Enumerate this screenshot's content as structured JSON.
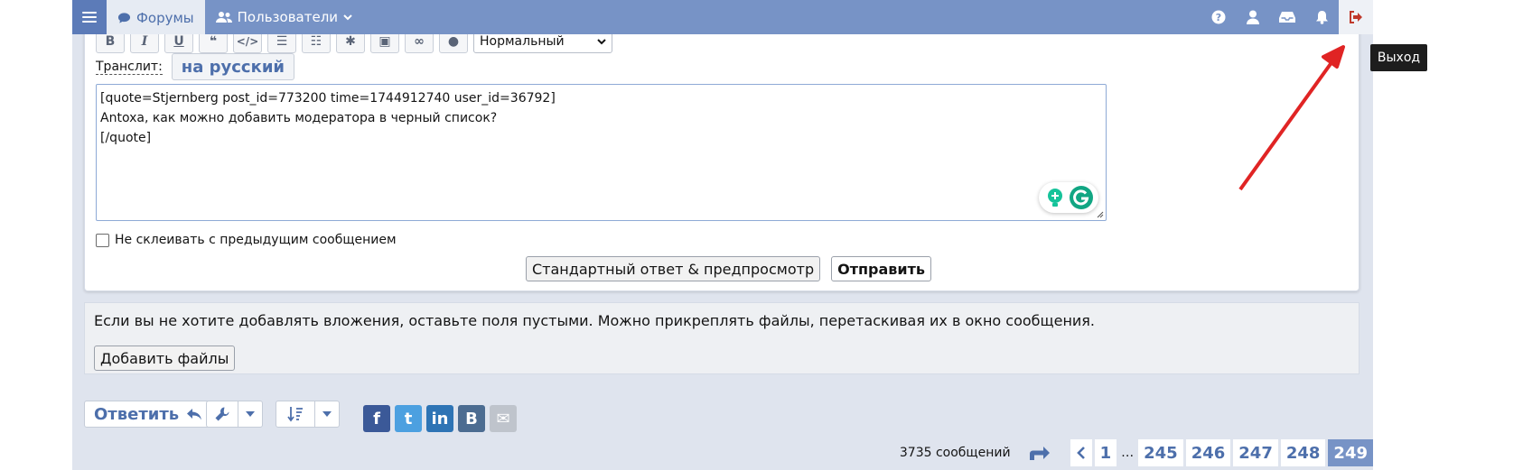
{
  "nav": {
    "forums_label": "Форумы",
    "users_label": "Пользователи",
    "logout_tooltip": "Выход"
  },
  "editor": {
    "format_select": "Нормальный",
    "translit_label": "Транслит:",
    "translit_button": "на русский",
    "lines": [
      "[quote=Stjernberg post_id=773200 time=1744912740 user_id=36792]",
      "Antoxa, как можно добавить модератора в черный список?",
      "[/quote]"
    ],
    "no_merge_label": "Не склеивать с предыдущим сообщением",
    "preview_button": "Стандартный ответ & предпросмотр",
    "submit_button": "Отправить"
  },
  "attachments": {
    "hint": "Если вы не хотите добавлять вложения, оставьте поля пустыми. Можно прикреплять файлы, перетаскивая их в окно сообщения.",
    "add_files_button": "Добавить файлы"
  },
  "bottom": {
    "reply_button": "Ответить",
    "share": [
      {
        "name": "facebook-icon",
        "glyph": "f",
        "color": "#3b5998"
      },
      {
        "name": "twitter-icon",
        "glyph": "t",
        "color": "#4ca0e0"
      },
      {
        "name": "linkedin-icon",
        "glyph": "in",
        "color": "#2e74b5"
      },
      {
        "name": "vk-icon",
        "glyph": "B",
        "color": "#4c6c91"
      },
      {
        "name": "email-icon",
        "glyph": "✉",
        "color": "#bfc4cc"
      }
    ],
    "message_count": "3735 сообщений",
    "pages": {
      "first": "1",
      "ellipsis": "…",
      "p1": "245",
      "p2": "246",
      "p3": "247",
      "p4": "248",
      "current": "249"
    }
  },
  "colors": {
    "nav_bg": "#7793c6",
    "accent": "#4d6fab",
    "annotation_arrow": "#e02424"
  }
}
